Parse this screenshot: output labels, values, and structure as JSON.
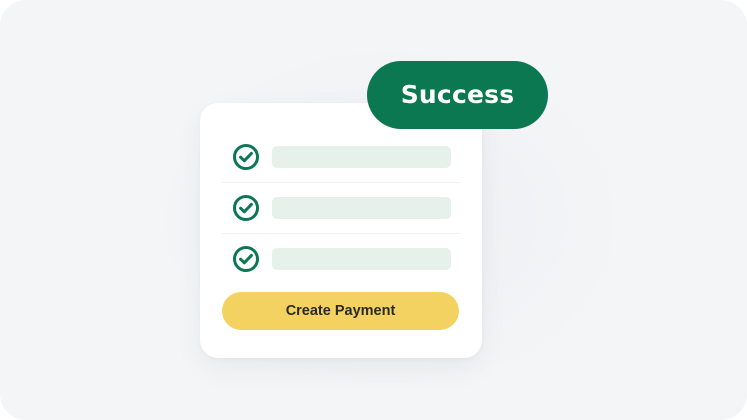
{
  "card": {
    "rows": [
      {
        "icon": "check-circle-icon",
        "state": "checked"
      },
      {
        "icon": "check-circle-icon",
        "state": "checked"
      },
      {
        "icon": "check-circle-icon",
        "state": "checked"
      }
    ],
    "button_label": "Create Payment"
  },
  "badge": {
    "label": "Success"
  },
  "colors": {
    "background": "#f4f5f7",
    "card": "#ffffff",
    "accent_green": "#0b7852",
    "placeholder_bar": "#e7f1ec",
    "button_yellow": "#f4d262",
    "button_text": "#2a2a22"
  }
}
